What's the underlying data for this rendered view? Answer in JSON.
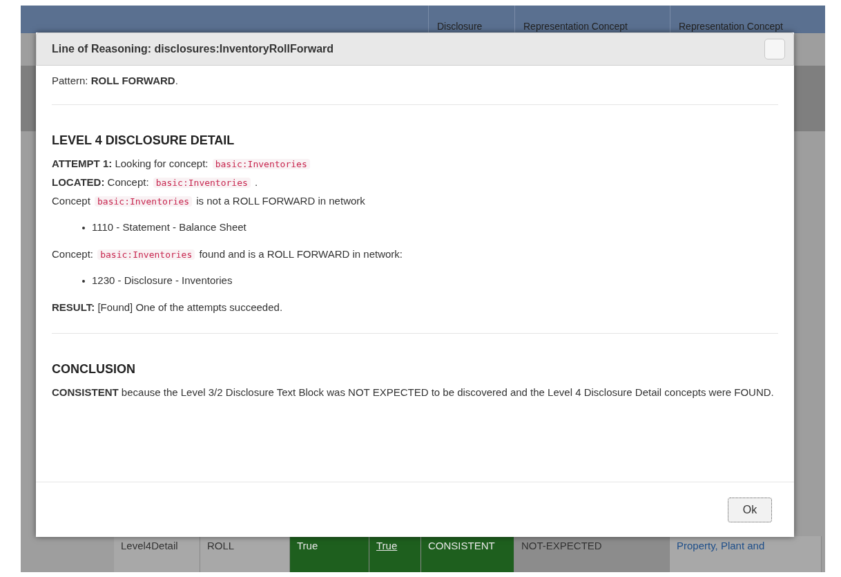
{
  "background_table": {
    "header": [
      "Disclosure",
      "Representation Concept",
      "Representation Concept"
    ],
    "row": [
      {
        "text": "Level4Detail",
        "kind": "plain"
      },
      {
        "text": "ROLL",
        "kind": "plain"
      },
      {
        "text": "True",
        "kind": "ok"
      },
      {
        "text": "True",
        "kind": "ok-link"
      },
      {
        "text": "CONSISTENT",
        "kind": "ok"
      },
      {
        "text": "NOT-EXPECTED",
        "kind": "muted"
      },
      {
        "text": "Property, Plant and",
        "kind": "link"
      }
    ]
  },
  "dialog": {
    "title": "Line of Reasoning: disclosures:InventoryRollForward",
    "pattern": [
      {
        "kind": "text",
        "text": "Pattern: "
      },
      {
        "kind": "bold",
        "text": "ROLL FORWARD"
      },
      {
        "kind": "text",
        "text": "."
      }
    ],
    "sections": [
      {
        "heading": "LEVEL 4 DISCLOSURE DETAIL",
        "blocks": [
          {
            "kind": "lines",
            "lines": [
              [
                {
                  "kind": "bold",
                  "text": "ATTEMPT 1:"
                },
                {
                  "kind": "text",
                  "text": " Looking for concept: "
                },
                {
                  "kind": "code",
                  "text": "basic:Inventories"
                }
              ],
              [
                {
                  "kind": "bold",
                  "text": "LOCATED:"
                },
                {
                  "kind": "text",
                  "text": " Concept: "
                },
                {
                  "kind": "code",
                  "text": "basic:Inventories"
                },
                {
                  "kind": "text",
                  "text": " ."
                }
              ],
              [
                {
                  "kind": "text",
                  "text": "Concept "
                },
                {
                  "kind": "code",
                  "text": "basic:Inventories"
                },
                {
                  "kind": "text",
                  "text": " is not a ROLL FORWARD in network"
                }
              ]
            ]
          },
          {
            "kind": "bullets",
            "items": [
              "1110 - Statement - Balance Sheet"
            ]
          },
          {
            "kind": "lines",
            "lines": [
              [
                {
                  "kind": "text",
                  "text": "Concept: "
                },
                {
                  "kind": "code",
                  "text": "basic:Inventories"
                },
                {
                  "kind": "text",
                  "text": " found and is a ROLL FORWARD in network:"
                }
              ]
            ]
          },
          {
            "kind": "bullets",
            "items": [
              "1230 - Disclosure - Inventories"
            ]
          },
          {
            "kind": "lines",
            "lines": [
              [
                {
                  "kind": "bold",
                  "text": "RESULT:"
                },
                {
                  "kind": "text",
                  "text": " [Found] One of the attempts succeeded."
                }
              ]
            ]
          }
        ]
      },
      {
        "heading": "CONCLUSION",
        "blocks": [
          {
            "kind": "lines",
            "lines": [
              [
                {
                  "kind": "bold",
                  "text": "CONSISTENT"
                },
                {
                  "kind": "text",
                  "text": " because the Level 3/2 Disclosure Text Block was NOT EXPECTED to be discovered and the Level 4 Disclosure Detail concepts were FOUND."
                }
              ]
            ]
          }
        ]
      }
    ],
    "ok_button": "Ok"
  }
}
